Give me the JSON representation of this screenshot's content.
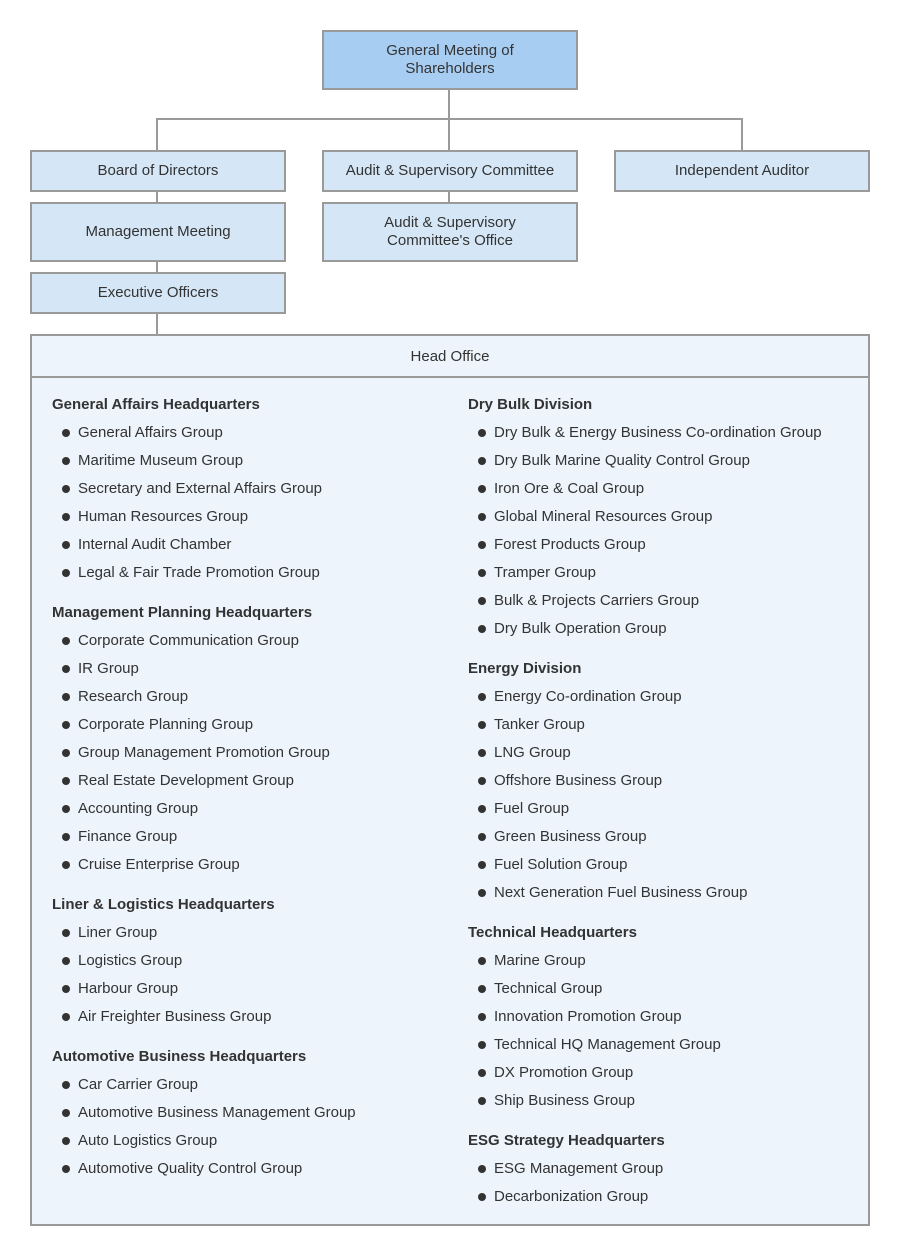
{
  "top": {
    "shareholders": "General Meeting of Shareholders",
    "board": "Board of Directors",
    "audit_committee": "Audit & Supervisory Committee",
    "independent_auditor": "Independent Auditor",
    "management_meeting": "Management Meeting",
    "audit_office": "Audit & Supervisory Committee's Office",
    "executive_officers": "Executive Officers"
  },
  "colors": {
    "top_box": "#a8cdf2",
    "box": "#d5e7f7",
    "head_office": "#edf4fb",
    "border": "#9a9a9a"
  },
  "head_office": {
    "title": "Head Office",
    "left": [
      {
        "title": "General Affairs Headquarters",
        "items": [
          "General Affairs Group",
          "Maritime Museum Group",
          "Secretary and External Affairs Group",
          "Human Resources Group",
          "Internal Audit Chamber",
          "Legal & Fair Trade Promotion Group"
        ]
      },
      {
        "title": "Management Planning Headquarters",
        "items": [
          "Corporate Communication Group",
          "IR Group",
          "Research Group",
          "Corporate Planning Group",
          "Group Management Promotion Group",
          "Real Estate Development Group",
          "Accounting Group",
          "Finance Group",
          "Cruise Enterprise Group"
        ]
      },
      {
        "title": "Liner & Logistics Headquarters",
        "items": [
          "Liner Group",
          "Logistics Group",
          "Harbour Group",
          "Air Freighter Business Group"
        ]
      },
      {
        "title": "Automotive Business Headquarters",
        "items": [
          "Car Carrier Group",
          "Automotive Business Management Group",
          "Auto Logistics Group",
          "Automotive Quality Control Group"
        ]
      }
    ],
    "right": [
      {
        "title": "Dry Bulk Division",
        "items": [
          "Dry Bulk & Energy Business Co-ordination Group",
          "Dry Bulk Marine Quality Control Group",
          "Iron Ore & Coal Group",
          "Global Mineral Resources Group",
          "Forest Products Group",
          "Tramper Group",
          "Bulk & Projects Carriers Group",
          "Dry Bulk Operation Group"
        ]
      },
      {
        "title": "Energy Division",
        "items": [
          "Energy Co-ordination Group",
          "Tanker Group",
          "LNG Group",
          "Offshore Business Group",
          "Fuel Group",
          "Green Business Group",
          "Fuel Solution Group",
          "Next Generation Fuel Business Group"
        ]
      },
      {
        "title": "Technical Headquarters",
        "items": [
          "Marine Group",
          "Technical Group",
          "Innovation Promotion Group",
          "Technical HQ Management Group",
          "DX Promotion Group",
          "Ship Business Group"
        ]
      },
      {
        "title": "ESG Strategy Headquarters",
        "items": [
          "ESG Management Group",
          "Decarbonization Group"
        ]
      }
    ]
  }
}
